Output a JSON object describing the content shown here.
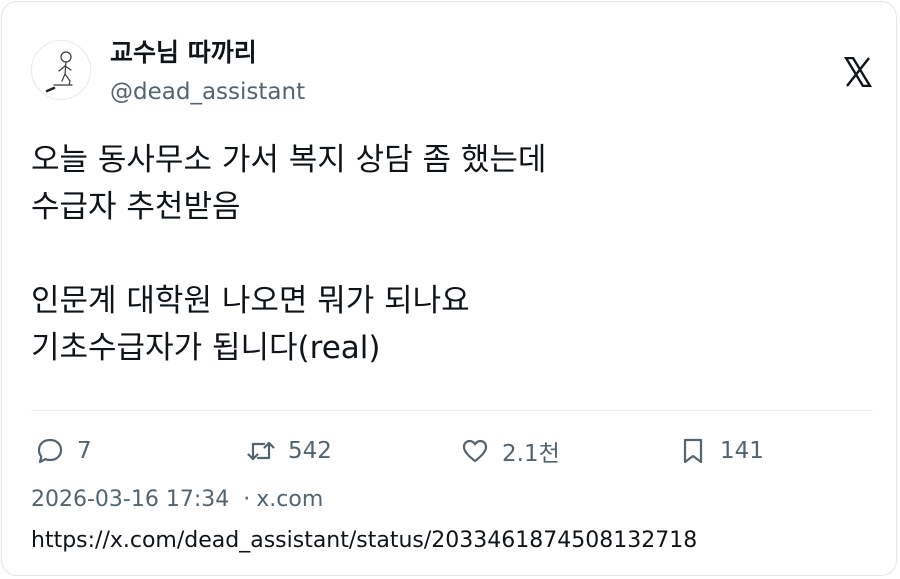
{
  "author": {
    "display_name": "교수님 따까리",
    "handle": "@dead_assistant"
  },
  "tweet": {
    "lines": [
      "오늘 동사무소 가서 복지 상담 좀 했는데",
      "수급자 추천받음",
      "",
      "인문계 대학원 나오면 뭐가 되나요",
      "기초수급자가 됩니다(real)"
    ]
  },
  "actions": {
    "replies": "7",
    "retweets": "542",
    "likes": "2.1천",
    "bookmarks": "141"
  },
  "meta": {
    "timestamp": "2026-03-16 17:34",
    "separator": "·",
    "source": "x.com"
  },
  "url": "https://x.com/dead_assistant/status/2033461874508132718",
  "icons": {
    "brand": "x-logo-icon",
    "reply": "speech-bubble-icon",
    "retweet": "retweet-arrows-icon",
    "like": "heart-icon",
    "bookmark": "bookmark-icon"
  },
  "colors": {
    "text": "#0f1419",
    "secondary": "#536471",
    "border": "#e3e6e8"
  }
}
